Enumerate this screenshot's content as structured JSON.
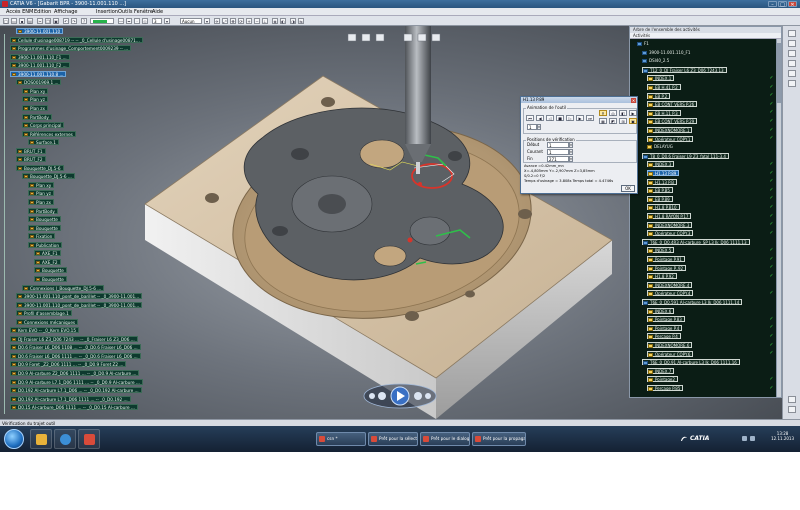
{
  "window": {
    "title": "CATIA V6 - [Gabarit BPR - 3900-11.001.110 ...]",
    "min": "–",
    "max": "□",
    "close": "✕"
  },
  "menubar": [
    "Accès ENM",
    "Edition",
    "Affichage",
    "Insertion",
    "Outils",
    "Fenêtre",
    "Aide"
  ],
  "toolbar": {
    "layer_value": "3",
    "filter_value": "Aucun"
  },
  "spec_tree": [
    {
      "label": "3900-11.001.110",
      "sel": true
    },
    {
      "label": "Cellule d'usinage008719 -- -- _0_Cellule d'usinage00871...",
      "sel": false
    },
    {
      "label": "Programmes d'usinage_Comportement0009239 -- ...",
      "sel": false
    },
    {
      "label": "3900-11.001.110_F1 ...",
      "sel": false
    },
    {
      "label": "3900-11.001.110_F2 ...",
      "sel": false
    },
    {
      "label": "3900-11.001.110.8 ...",
      "sel": true
    },
    {
      "label": "DOS001969.1 ...",
      "sel": false
    },
    {
      "label": "Plan xy",
      "sel": false
    },
    {
      "label": "Plan yz",
      "sel": false
    },
    {
      "label": "Plan zx",
      "sel": false
    },
    {
      "label": "PartBody",
      "sel": false
    },
    {
      "label": "Corps principal",
      "sel": false
    },
    {
      "label": "Références externes",
      "sel": false
    },
    {
      "label": "Surface.1",
      "sel": false
    },
    {
      "label": "BRUT_F1",
      "sel": false
    },
    {
      "label": "BRUT_F2",
      "sel": false
    },
    {
      "label": "Bouquette_DJ.5-6",
      "sel": false
    },
    {
      "label": "Bouquette_DJ.5-6 ...",
      "sel": false
    },
    {
      "label": "Plan xy",
      "sel": false
    },
    {
      "label": "Plan yz",
      "sel": false
    },
    {
      "label": "Plan zx",
      "sel": false
    },
    {
      "label": "PartBody",
      "sel": false
    },
    {
      "label": "Bouquette",
      "sel": false
    },
    {
      "label": "Bouquette",
      "sel": false
    },
    {
      "label": "Fixation",
      "sel": false
    },
    {
      "label": "Publication",
      "sel": false
    },
    {
      "label": "AXE_F1",
      "sel": false
    },
    {
      "label": "AXE_F2",
      "sel": false
    },
    {
      "label": "Bouquette",
      "sel": false
    },
    {
      "label": "Bouquette",
      "sel": false
    },
    {
      "label": "Connexions (_Bouquette_DJ.5-6 ...",
      "sel": false
    },
    {
      "label": "3900-11.001.110_pont_de_barillet -- _0_3900-11.001...",
      "sel": false
    },
    {
      "label": "3900-11.001.110_pont_de_barillet -- _0_3900-11.001...",
      "sel": false
    },
    {
      "label": "Profil d'assemblage.1",
      "sel": false
    },
    {
      "label": "Connexions mécaniques",
      "sel": false
    },
    {
      "label": "Kern EVO -- _0_Kern EVO.15",
      "sel": false
    },
    {
      "label": "DJ Fraiser L6 Z3_D06 7243 ... -- _0_Fraiser L6 Z3_D06 ...",
      "sel": false
    },
    {
      "label": "D0.6 Fraiser L6_D06 1108 ... -- _0_D0.6 Fraiser L6_D06 ...",
      "sel": false
    },
    {
      "label": "D0.6 Fraiser L6_D06 1111 ... -- _0_D0.6 Fraiser L6_D06 ...",
      "sel": false
    },
    {
      "label": "D0.9 Foret _Z2_D06 1111 ... -- _0_D0.9 Foret Z2 ...",
      "sel": false
    },
    {
      "label": "D0.9 Al-carbure Z2_D06 1111 ... -- _0_D0.9 Al-carbure ...",
      "sel": false
    },
    {
      "label": "D0.9 Al-carbure L7.1_D06 1111 ... -- _0_D0.9 Al-carbure ...",
      "sel": false
    },
    {
      "label": "D0.192 Al-carbure L7.1_D06 ... -- _0_D0.192 Al-carbure ...",
      "sel": false
    },
    {
      "label": "D0.192 Al-carbure L7.1_D06 1111 ... -- _0_D0.192 ...",
      "sel": false
    },
    {
      "label": "D0.15 Al-carbure_D06 1111 ... -- _0_D0.15 Al-carbure ...",
      "sel": false
    }
  ],
  "activities": {
    "header": "Arbre de l'ensemble des activités",
    "subheader": "Activités",
    "rows": [
      {
        "label": "F1",
        "kind": "grp",
        "indent": 1,
        "style": "",
        "check": false
      },
      {
        "label": "3900-11.001.110_F1",
        "kind": "grp",
        "indent": 2,
        "style": "",
        "check": false
      },
      {
        "label": "DSI40_2.5",
        "kind": "grp",
        "indent": 2,
        "style": "",
        "check": false
      },
      {
        "label": "T12_0_DJ Fraiser L6 Z3_D06 7243.13",
        "kind": "grp",
        "indent": 2,
        "style": "boxed",
        "check": false
      },
      {
        "label": "INDEX.1",
        "kind": "op",
        "indent": 3,
        "style": "boxed",
        "check": true
      },
      {
        "label": "EB H.41 P.2",
        "kind": "op",
        "indent": 3,
        "style": "boxed",
        "check": true
      },
      {
        "label": "EB P.2",
        "kind": "op",
        "indent": 3,
        "style": "boxed",
        "check": true
      },
      {
        "label": "EB CONT VERS P.26",
        "kind": "op",
        "indent": 3,
        "style": "boxed",
        "check": true
      },
      {
        "label": "EB H.11 P.3",
        "kind": "op",
        "indent": 3,
        "style": "boxed",
        "check": true
      },
      {
        "label": "EB CONT VERS P.29",
        "kind": "op",
        "indent": 3,
        "style": "boxed",
        "check": true
      },
      {
        "label": "INDEXNOMORE.1",
        "kind": "op",
        "indent": 3,
        "style": "boxed",
        "check": true
      },
      {
        "label": "Opérateur COPY.1",
        "kind": "op",
        "indent": 3,
        "style": "boxed",
        "check": true
      },
      {
        "label": "DELAYUG",
        "kind": "op",
        "indent": 3,
        "style": "",
        "check": false
      },
      {
        "label": "T8_0_D0.6 Fraiser L9 Z3_fatal 111-3.4",
        "kind": "grp",
        "indent": 2,
        "style": "boxed",
        "check": false
      },
      {
        "label": "INDEX.3",
        "kind": "op",
        "indent": 3,
        "style": "boxed",
        "check": true
      },
      {
        "label": "H1.13 P.89",
        "kind": "op",
        "indent": 3,
        "style": "sel",
        "check": true
      },
      {
        "label": "H1.13 P.B",
        "kind": "op",
        "indent": 3,
        "style": "boxed",
        "check": true
      },
      {
        "label": "EB P.B5",
        "kind": "op",
        "indent": 3,
        "style": "boxed",
        "check": true
      },
      {
        "label": "EB P.89",
        "kind": "op",
        "indent": 3,
        "style": "boxed",
        "check": true
      },
      {
        "label": "H1.8 P.B10",
        "kind": "op",
        "indent": 3,
        "style": "boxed",
        "check": true
      },
      {
        "label": "H1.8 RAYON P.17",
        "kind": "op",
        "indent": 3,
        "style": "boxed",
        "check": true
      },
      {
        "label": "INDEXNOMORE.3",
        "kind": "op",
        "indent": 3,
        "style": "boxed",
        "check": true
      },
      {
        "label": "Opérateur COPY.3",
        "kind": "op",
        "indent": 3,
        "style": "boxed",
        "check": true
      },
      {
        "label": "T6E_0_D0.4R3 Al-carbure_SP L3 Ik_D06 1111.13",
        "kind": "grp",
        "indent": 2,
        "style": "boxed",
        "check": false
      },
      {
        "label": "INDEX.5",
        "kind": "op",
        "indent": 3,
        "style": "boxed",
        "check": true
      },
      {
        "label": "Pointage P.91",
        "kind": "op",
        "indent": 3,
        "style": "boxed",
        "check": true
      },
      {
        "label": "Pointage P..92",
        "kind": "op",
        "indent": 3,
        "style": "boxed",
        "check": true
      },
      {
        "label": "H1.8 P.92",
        "kind": "op",
        "indent": 3,
        "style": "boxed",
        "check": true
      },
      {
        "label": "INDEXNOMORE.4",
        "kind": "op",
        "indent": 3,
        "style": "boxed",
        "check": false
      },
      {
        "label": "Opérateur COPY.4",
        "kind": "op",
        "indent": 3,
        "style": "boxed",
        "check": true
      },
      {
        "label": "T6E_0_D0.591 Al-carbure L3 Ik_D06 1111.14",
        "kind": "grp",
        "indent": 2,
        "style": "boxed",
        "check": false
      },
      {
        "label": "INDEX.6",
        "kind": "op",
        "indent": 3,
        "style": "boxed",
        "check": false
      },
      {
        "label": "Pointage P.83",
        "kind": "op",
        "indent": 3,
        "style": "boxed",
        "check": true
      },
      {
        "label": "Pointage P.4",
        "kind": "op",
        "indent": 3,
        "style": "boxed",
        "check": true
      },
      {
        "label": "Perçage P.4",
        "kind": "op",
        "indent": 3,
        "style": "boxed",
        "check": true
      },
      {
        "label": "INDEXNOMORE.6",
        "kind": "op",
        "indent": 3,
        "style": "boxed",
        "check": true
      },
      {
        "label": "Opérateur COPY.6",
        "kind": "op",
        "indent": 3,
        "style": "boxed",
        "check": true
      },
      {
        "label": "T6E_0_D0.91 Al-carbure L3 Ik_D06 1111.16",
        "kind": "grp",
        "indent": 2,
        "style": "boxed",
        "check": false
      },
      {
        "label": "INDEX.7",
        "kind": "op",
        "indent": 3,
        "style": "boxed",
        "check": false
      },
      {
        "label": "Pointage2",
        "kind": "op",
        "indent": 3,
        "style": "boxed",
        "check": true
      },
      {
        "label": "Perçage P.85",
        "kind": "op",
        "indent": 3,
        "style": "boxed",
        "check": true
      }
    ]
  },
  "sim_dialog": {
    "title": "H1.13 P.89",
    "anim_group": "Animation de l'outil",
    "step_value": "1",
    "verif_group": "Positions de vérification",
    "debut_label": "Début",
    "debut_value": "1",
    "courant_label": "Courant",
    "courant_value": "1",
    "fin_label": "Fin",
    "fin_value": "271",
    "info1": "Avance =0.42mm_mn",
    "info2": "X=-4,805mm Y=-2,907mm Z=3,85mm",
    "info3": "S/0.2=0 F/2",
    "info4": "Temps d'usinage = 3.808s   Temps total = 4.4746s",
    "ok": "OK"
  },
  "status": {
    "text": "Vérification du trajet outil"
  },
  "taskbar": {
    "windows": [
      {
        "label": "csn *"
      },
      {
        "label": "Prêt pour la sélection"
      },
      {
        "label": "Prêt pour le dialogue"
      },
      {
        "label": "Prêt pour la propagation"
      }
    ],
    "brand": "CATIA",
    "clock_time": "13:28",
    "clock_date": "12.11.2013"
  },
  "colors": {
    "accent": "#1c63a8",
    "check": "#39c93f",
    "tree_bg": "#0d3a2e"
  }
}
